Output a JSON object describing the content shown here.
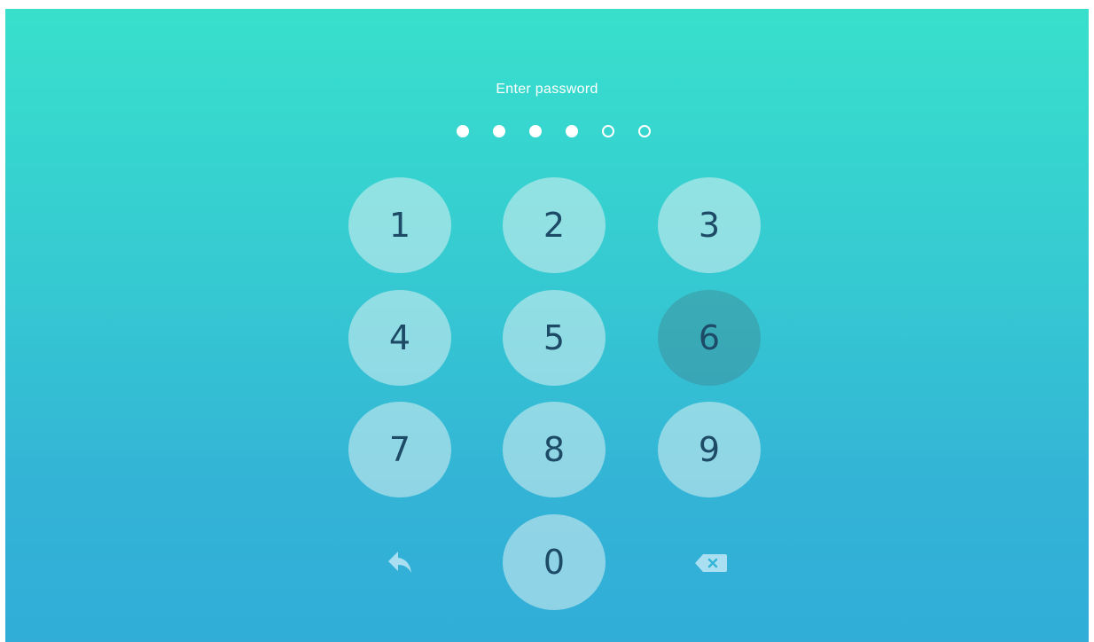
{
  "title": "Enter password",
  "password": {
    "length": 6,
    "entered": 4
  },
  "keypad": {
    "keys": [
      "1",
      "2",
      "3",
      "4",
      "5",
      "6",
      "7",
      "8",
      "9",
      "0"
    ],
    "pressed_key": "6"
  },
  "actions": {
    "back_icon": "reply-arrow-icon",
    "delete_icon": "backspace-icon"
  },
  "colors": {
    "gradient_top": "#38e0cc",
    "gradient_bottom": "#31add8",
    "key_text": "#1d4a66",
    "dot": "#ffffff"
  }
}
